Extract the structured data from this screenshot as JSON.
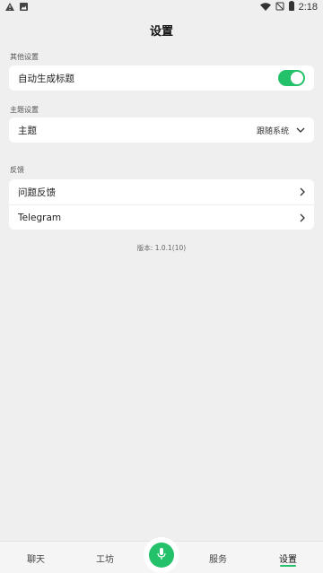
{
  "status_bar": {
    "time": "2:18",
    "left_icons": [
      "warning-icon",
      "image-icon"
    ],
    "right_icons": [
      "wifi-icon",
      "no-sim-icon",
      "battery-icon"
    ]
  },
  "header": {
    "title": "设置"
  },
  "sections": {
    "other": {
      "label": "其他设置",
      "auto_title": {
        "label": "自动生成标题",
        "enabled": true
      }
    },
    "theme": {
      "label": "主题设置",
      "theme_row": {
        "label": "主题",
        "value": "跟随系统"
      }
    },
    "feedback": {
      "label": "反馈",
      "items": [
        {
          "label": "问题反馈"
        },
        {
          "label": "Telegram"
        }
      ]
    }
  },
  "version": "版本: 1.0.1(10)",
  "bottom_nav": {
    "items": [
      {
        "label": "聊天"
      },
      {
        "label": "工坊"
      },
      {
        "label": "服务"
      },
      {
        "label": "设置"
      }
    ],
    "active": "设置",
    "accent_color": "#22c16a"
  }
}
